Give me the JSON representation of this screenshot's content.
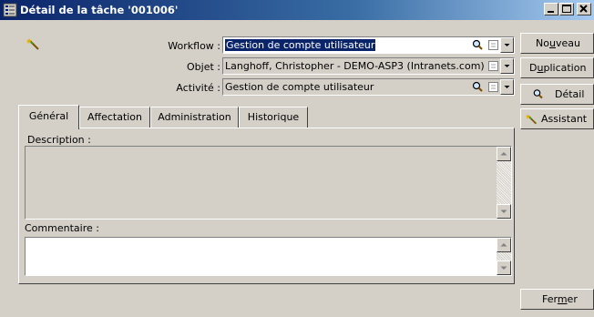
{
  "window": {
    "title": "Détail de la tâche '001006'",
    "icon": "task-window-icon",
    "controls": [
      "minimize",
      "maximize",
      "close"
    ]
  },
  "form": {
    "record_icon": "wizard-wand-icon",
    "workflow": {
      "label": "Workflow :",
      "value": "Gestion de compte utilisateur",
      "selected": true
    },
    "objet": {
      "label": "Objet :",
      "value": "Langhoff, Christopher - DEMO-ASP3 (Intranets.com)"
    },
    "activite": {
      "label": "Activité :",
      "value": "Gestion de compte utilisateur"
    }
  },
  "tabs": [
    {
      "label": "Général",
      "active": true
    },
    {
      "label": "Affectation",
      "active": false
    },
    {
      "label": "Administration",
      "active": false
    },
    {
      "label": "Historique",
      "active": false
    }
  ],
  "general": {
    "description_label": "Description :",
    "commentaire_label": "Commentaire :"
  },
  "buttons": {
    "nouveau": {
      "pre": "No",
      "mnemonic": "u",
      "post": "veau"
    },
    "duplication": {
      "pre": "D",
      "mnemonic": "u",
      "post": "plication"
    },
    "detail": {
      "label": "Détail"
    },
    "assistant": {
      "label": "Assistant"
    },
    "fermer": {
      "pre": "Fer",
      "mnemonic": "m",
      "post": "er"
    }
  },
  "colors": {
    "titlebar_start": "#0a246a",
    "titlebar_end": "#a6caf0",
    "face": "#d4d0c8",
    "selection": "#0a246a"
  }
}
